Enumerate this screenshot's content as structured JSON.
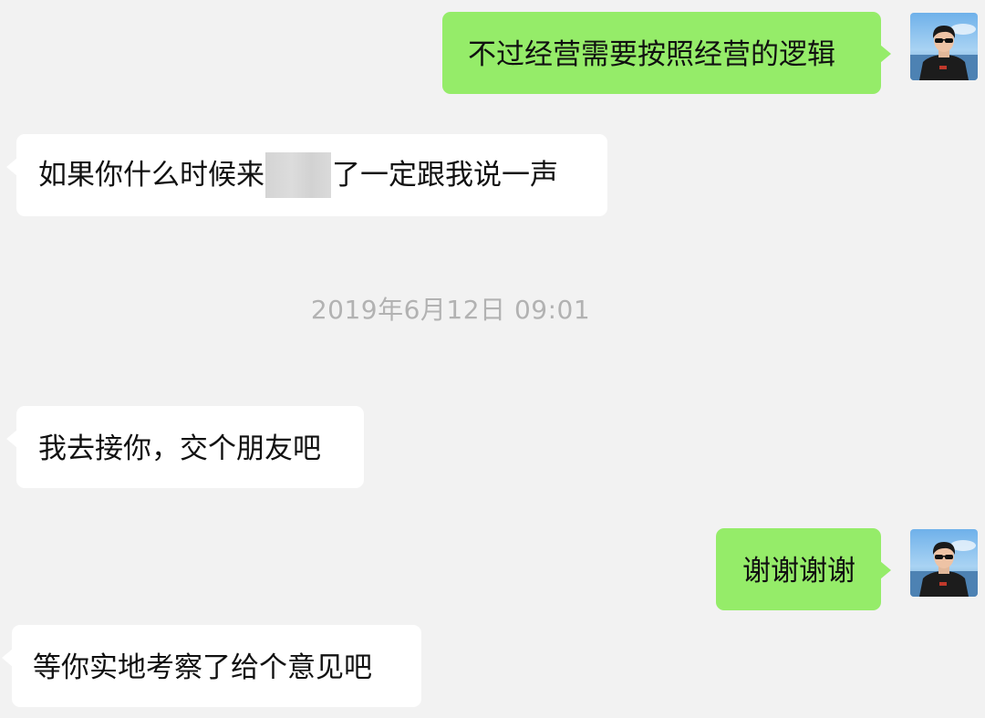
{
  "messages": [
    {
      "direction": "outgoing",
      "text": "不过经营需要按照经营的逻辑"
    },
    {
      "direction": "incoming",
      "text_before": "如果你什么时候来",
      "text_after": "了一定跟我说一声"
    },
    {
      "direction": "incoming",
      "text": "我去接你，交个朋友吧"
    },
    {
      "direction": "outgoing",
      "text": "谢谢谢谢"
    },
    {
      "direction": "incoming",
      "text": "等你实地考察了给个意见吧"
    }
  ],
  "timestamp": "2019年6月12日 09:01",
  "colors": {
    "background": "#f2f2f2",
    "outgoing_bubble": "#95ec69",
    "incoming_bubble": "#ffffff",
    "timestamp_text": "#b2b2b2"
  },
  "icons": {
    "self_avatar": "user-avatar-photo",
    "redaction": "blurred-redaction"
  }
}
